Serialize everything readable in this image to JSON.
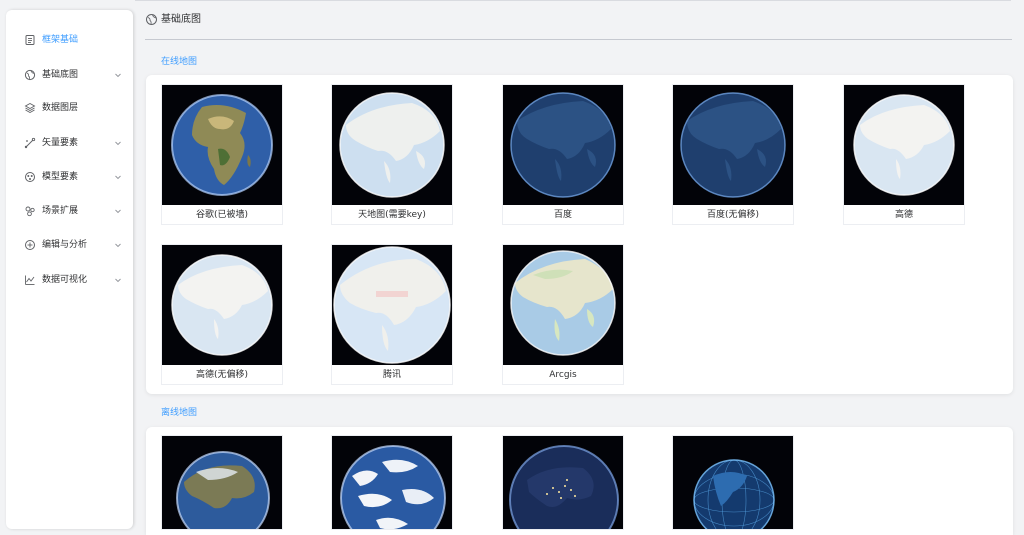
{
  "sidebar": {
    "items": [
      {
        "label": "框架基础",
        "icon": "document-icon",
        "active": true,
        "has_arrow": false
      },
      {
        "label": "基础底图",
        "icon": "globe-icon",
        "active": false,
        "has_arrow": true
      },
      {
        "label": "数据图层",
        "icon": "layers-icon",
        "active": false,
        "has_arrow": false
      },
      {
        "label": "矢量要素",
        "icon": "vector-pen-icon",
        "active": false,
        "has_arrow": true
      },
      {
        "label": "模型要素",
        "icon": "model-icon",
        "active": false,
        "has_arrow": true
      },
      {
        "label": "场景扩展",
        "icon": "cluster-icon",
        "active": false,
        "has_arrow": true
      },
      {
        "label": "编辑与分析",
        "icon": "edit-analysis-icon",
        "active": false,
        "has_arrow": true
      },
      {
        "label": "数据可视化",
        "icon": "chart-icon",
        "active": false,
        "has_arrow": true
      }
    ]
  },
  "header": {
    "title": "基础底图",
    "icon": "globe-icon"
  },
  "online": {
    "section_title": "在线地图",
    "cards": [
      {
        "label": "谷歌(已被墙)",
        "style": "satellite-africa"
      },
      {
        "label": "天地图(需要key)",
        "style": "light-asia"
      },
      {
        "label": "百度",
        "style": "dark-blue-asia"
      },
      {
        "label": "百度(无偏移)",
        "style": "dark-blue-asia"
      },
      {
        "label": "高德",
        "style": "light-asia"
      },
      {
        "label": "高德(无偏移)",
        "style": "light-asia"
      },
      {
        "label": "腾讯",
        "style": "light-asia-red"
      },
      {
        "label": "Arcgis",
        "style": "street-asia"
      }
    ]
  },
  "offline": {
    "section_title": "离线地图",
    "cards": [
      {
        "style": "satellite-asia"
      },
      {
        "style": "cloudy-earth"
      },
      {
        "style": "night-lights"
      },
      {
        "style": "wireframe-americas"
      }
    ]
  },
  "colors": {
    "accent": "#409eff",
    "text": "#303133",
    "background": "#f2f3f5",
    "panel": "#ffffff"
  }
}
